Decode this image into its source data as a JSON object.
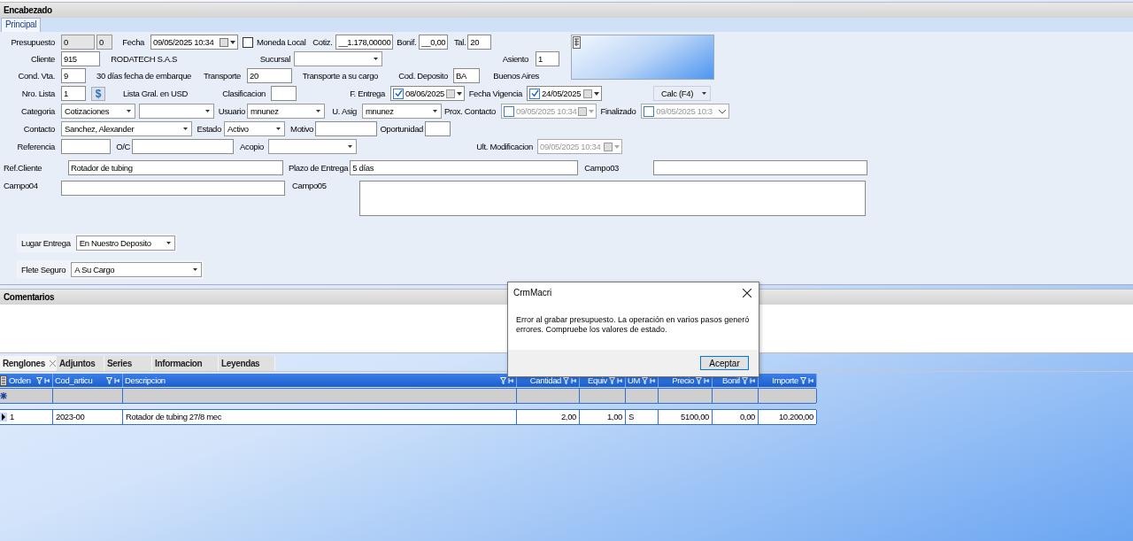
{
  "section_title": "Encabezado",
  "tabs": [
    {
      "label": "Principal",
      "selected": true
    }
  ],
  "top_rows": [
    [
      {
        "kind": "label",
        "text": "Presupuesto"
      },
      {
        "kind": "text",
        "value": "0",
        "readonly": true
      },
      {
        "kind": "text",
        "value": "0",
        "readonly": true
      },
      {
        "kind": "label",
        "text": "Fecha"
      },
      {
        "kind": "date",
        "value": "09/05/2025 10:34"
      },
      {
        "kind": "check",
        "label": "Moneda Local",
        "checked": false
      },
      {
        "kind": "label",
        "text": "Cotiz."
      },
      {
        "kind": "text",
        "value": "__1.178,00000"
      },
      {
        "kind": "label",
        "text": "Bonif."
      },
      {
        "kind": "text",
        "value": "__0,00"
      },
      {
        "kind": "label",
        "text": "Tal."
      },
      {
        "kind": "text",
        "value": "20"
      }
    ],
    [
      {
        "kind": "label",
        "text": "Cliente"
      },
      {
        "kind": "text",
        "value": "915"
      },
      {
        "kind": "label",
        "text": "RODATECH S.A.S"
      },
      {
        "kind": "label",
        "text": "Sucursal"
      },
      {
        "kind": "combo"
      },
      {
        "kind": "label",
        "text": "Asiento"
      },
      {
        "kind": "text",
        "value": "1"
      }
    ],
    [
      {
        "kind": "label",
        "text": "Cond. Vta."
      },
      {
        "kind": "text",
        "value": "9"
      },
      {
        "kind": "label",
        "text": "30 días fecha de embarque"
      },
      {
        "kind": "label",
        "text": "Transporte"
      },
      {
        "kind": "text",
        "value": "20"
      },
      {
        "kind": "label",
        "text": "Transporte a su cargo"
      },
      {
        "kind": "label",
        "text": "Cod. Deposito"
      },
      {
        "kind": "text",
        "value": "BA"
      },
      {
        "kind": "label",
        "text": "Buenos Aires"
      }
    ]
  ],
  "rows": [
    [
      {
        "kind": "label",
        "text": "Nro. Lista"
      },
      {
        "kind": "text",
        "value": "1"
      },
      {
        "kind": "dollar",
        "text": "$"
      },
      {
        "kind": "label",
        "text": "Lista Gral. en USD"
      },
      {
        "kind": "label",
        "text": "Clasificacion"
      },
      {
        "kind": "text"
      },
      {
        "kind": "label",
        "text": "F. Entrega"
      },
      {
        "kind": "date",
        "value": "08/06/2025",
        "checkbox": true,
        "checked": true
      },
      {
        "kind": "label",
        "text": "Fecha Vigencia"
      },
      {
        "kind": "date",
        "value": "24/05/2025",
        "checkbox": true,
        "checked": true
      },
      {
        "kind": "combo",
        "value": "Calc (F4)",
        "flat": true
      }
    ],
    [
      {
        "kind": "label",
        "text": "Categoria"
      },
      {
        "kind": "combo",
        "value": "Cotizaciones"
      },
      {
        "kind": "combo"
      },
      {
        "kind": "label",
        "text": "Usuario"
      },
      {
        "kind": "combo",
        "value": "mnunez"
      },
      {
        "kind": "label",
        "text": "U. Asig"
      },
      {
        "kind": "combo",
        "value": "mnunez"
      },
      {
        "kind": "label",
        "text": "Prox. Contacto"
      },
      {
        "kind": "date",
        "value": "09/05/2025 10:34",
        "checkbox": true,
        "checked": false,
        "disabled": true
      },
      {
        "kind": "label",
        "text": "Finalizado"
      },
      {
        "kind": "date",
        "value": "09/05/2025 10:3",
        "checkbox": true,
        "checked": false,
        "disabled": true,
        "chevron": true
      }
    ],
    [
      {
        "kind": "label",
        "text": "Contacto"
      },
      {
        "kind": "combo",
        "value": "Sanchez, Alexander"
      },
      {
        "kind": "label",
        "text": "Estado"
      },
      {
        "kind": "combo",
        "value": "Activo"
      },
      {
        "kind": "label",
        "text": "Motivo"
      },
      {
        "kind": "text"
      },
      {
        "kind": "label",
        "text": "Oportunidad"
      },
      {
        "kind": "text"
      }
    ],
    [
      {
        "kind": "label",
        "text": "Referencia"
      },
      {
        "kind": "text"
      },
      {
        "kind": "label",
        "text": "O/C"
      },
      {
        "kind": "text"
      },
      {
        "kind": "label",
        "text": "Acopio"
      },
      {
        "kind": "combo"
      },
      {
        "kind": "label",
        "text": "Ult. Modificacion"
      },
      {
        "kind": "date",
        "value": "09/05/2025 10:34",
        "disabled": true
      }
    ],
    [
      {
        "kind": "label",
        "text": "Ref.Cliente"
      },
      {
        "kind": "text",
        "value": "Rotador de tubing"
      },
      {
        "kind": "label",
        "text": "Plazo de Entrega"
      },
      {
        "kind": "text",
        "value": "5 días"
      },
      {
        "kind": "label",
        "text": "Campo03"
      },
      {
        "kind": "text"
      }
    ],
    [
      {
        "kind": "label",
        "text": "Campo04"
      },
      {
        "kind": "text"
      },
      {
        "kind": "label",
        "text": "Campo05"
      },
      {
        "kind": "area"
      }
    ]
  ],
  "delivery": [
    {
      "label": "Lugar Entrega",
      "value": "En Nuestro Deposito"
    },
    {
      "label": "Flete  Seguro",
      "value": "A Su Cargo"
    }
  ],
  "comments_title": "Comentarios",
  "detail_tabs": [
    {
      "label": "Renglones",
      "selected": true,
      "closable": true
    },
    {
      "label": "Adjuntos",
      "selected": false,
      "closable": false
    },
    {
      "label": "Series",
      "selected": false,
      "closable": false
    },
    {
      "label": "Informacion",
      "selected": false,
      "closable": false
    },
    {
      "label": "Leyendas",
      "selected": false,
      "closable": false
    }
  ],
  "grid": {
    "columns": [
      {
        "label": "Orden"
      },
      {
        "label": "Cod_articu"
      },
      {
        "label": "Descripcion"
      },
      {
        "label": "Cantidad"
      },
      {
        "label": "Equiv"
      },
      {
        "label": "UM"
      },
      {
        "label": "Precio"
      },
      {
        "label": "Bonif"
      },
      {
        "label": "Importe"
      }
    ],
    "rows": [
      {
        "current": true,
        "cells": [
          "1",
          "2023-00",
          "Rotador de tubing 27/8 mec",
          "2,00",
          "1,00",
          "S",
          "5100,00",
          "0,00",
          "10.200,00"
        ]
      }
    ]
  },
  "dialog": {
    "title": "CrmMacri",
    "message": "Error al grabar presupuesto. La operación en varios pasos generó errores. Compruebe los valores de estado.",
    "button": "Aceptar"
  }
}
